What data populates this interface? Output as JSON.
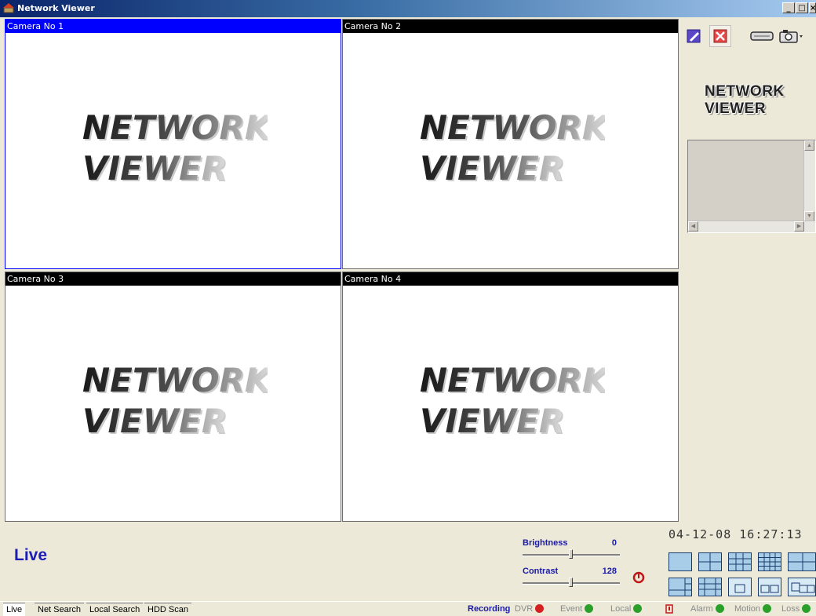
{
  "window": {
    "title": "Network Viewer"
  },
  "cameras": [
    {
      "label": "Camera No 1",
      "selected": true
    },
    {
      "label": "Camera No 2",
      "selected": false
    },
    {
      "label": "Camera No 3",
      "selected": false
    },
    {
      "label": "Camera No 4",
      "selected": false
    }
  ],
  "placeholder_logo": {
    "line1": "NETWORK",
    "line2": "VIEWER"
  },
  "side_panel": {
    "logo_line1": "NETWORK",
    "logo_line2": "VIEWER",
    "tool_icons": [
      "edit-icon",
      "cancel-icon",
      "hdd-icon",
      "camera-icon"
    ]
  },
  "mode_label": "Live",
  "brightness": {
    "label": "Brightness",
    "value": "0",
    "level": 0.5
  },
  "contrast": {
    "label": "Contrast",
    "value": "128",
    "level": 0.5
  },
  "datetime": "04-12-08 16:27:13",
  "layout_buttons": [
    "single",
    "quad",
    "grid-9",
    "grid-16",
    "grid-6",
    "grid-8",
    "grid-13",
    "grid-1a",
    "grid-2",
    "grid-3"
  ],
  "tabs": [
    "Live",
    "Net Search",
    "Local Search",
    "HDD Scan"
  ],
  "status": {
    "recording_label": "Recording",
    "items": [
      {
        "label": "DVR",
        "color": "#d62020"
      },
      {
        "label": "Event",
        "color": "#2aa02a"
      },
      {
        "label": "Local",
        "color": "#2aa02a"
      },
      {
        "label": "Alarm",
        "color": "#2aa02a"
      },
      {
        "label": "Motion",
        "color": "#2aa02a"
      },
      {
        "label": "Loss",
        "color": "#2aa02a"
      }
    ]
  },
  "colors": {
    "selected_header": "#0000ff",
    "accent_text": "#1c1cb8"
  }
}
